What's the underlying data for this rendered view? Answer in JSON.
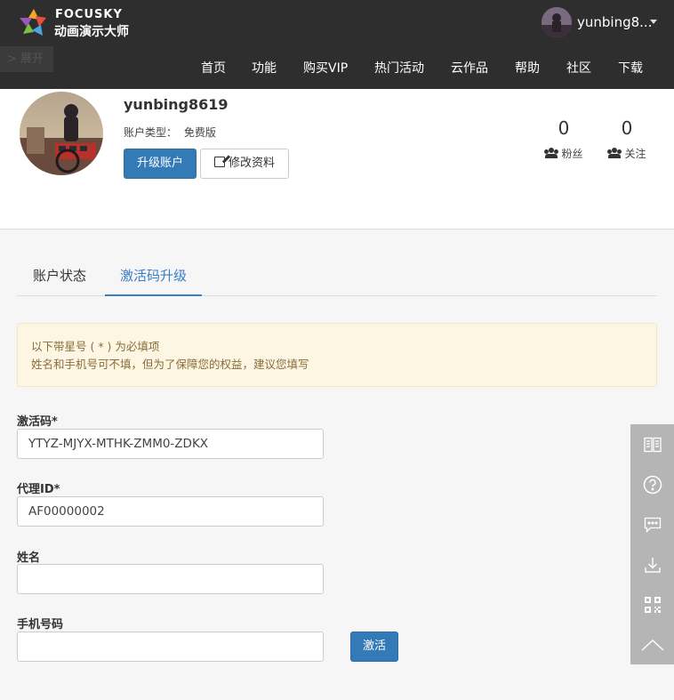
{
  "header": {
    "logo_en": "FOCUSKY",
    "logo_cn": "动画演示大师",
    "expand_label": "> 展开",
    "username_short": "yunbing8...",
    "nav": [
      "首页",
      "功能",
      "购买VIP",
      "热门活动",
      "云作品",
      "帮助",
      "社区",
      "下载"
    ]
  },
  "profile": {
    "username": "yunbing8619",
    "account_type_label": "账户类型：",
    "account_type_value": "免费版",
    "upgrade_label": "升级账户",
    "edit_label": "修改资料",
    "fans_count": "0",
    "fans_label": "粉丝",
    "follow_count": "0",
    "follow_label": "关注"
  },
  "tabs": {
    "status": "账户状态",
    "activate": "激活码升级",
    "active": "activate"
  },
  "notice": {
    "line1": "以下带星号 ( * ) 为必填项",
    "line2": "姓名和手机号可不填，但为了保障您的权益，建议您填写"
  },
  "form": {
    "code_label": "激活码*",
    "code_value": "YTYZ-MJYX-MTHK-ZMM0-ZDKX",
    "agent_label": "代理ID*",
    "agent_value": "AF00000002",
    "name_label": "姓名",
    "name_value": "",
    "phone_label": "手机号码",
    "phone_value": "",
    "submit_label": "激活"
  },
  "colors": {
    "header_bg": "#2e2e2e",
    "primary": "#337ab7",
    "tab_active": "#3a7dc9",
    "notice_bg": "#fcf6e3",
    "notice_text": "#8a6d3b",
    "sidebar_bg": "#b5b5b5"
  },
  "sidebar_icons": [
    "book-icon",
    "help-icon",
    "chat-icon",
    "download-icon",
    "qrcode-icon",
    "back-to-top-icon"
  ]
}
